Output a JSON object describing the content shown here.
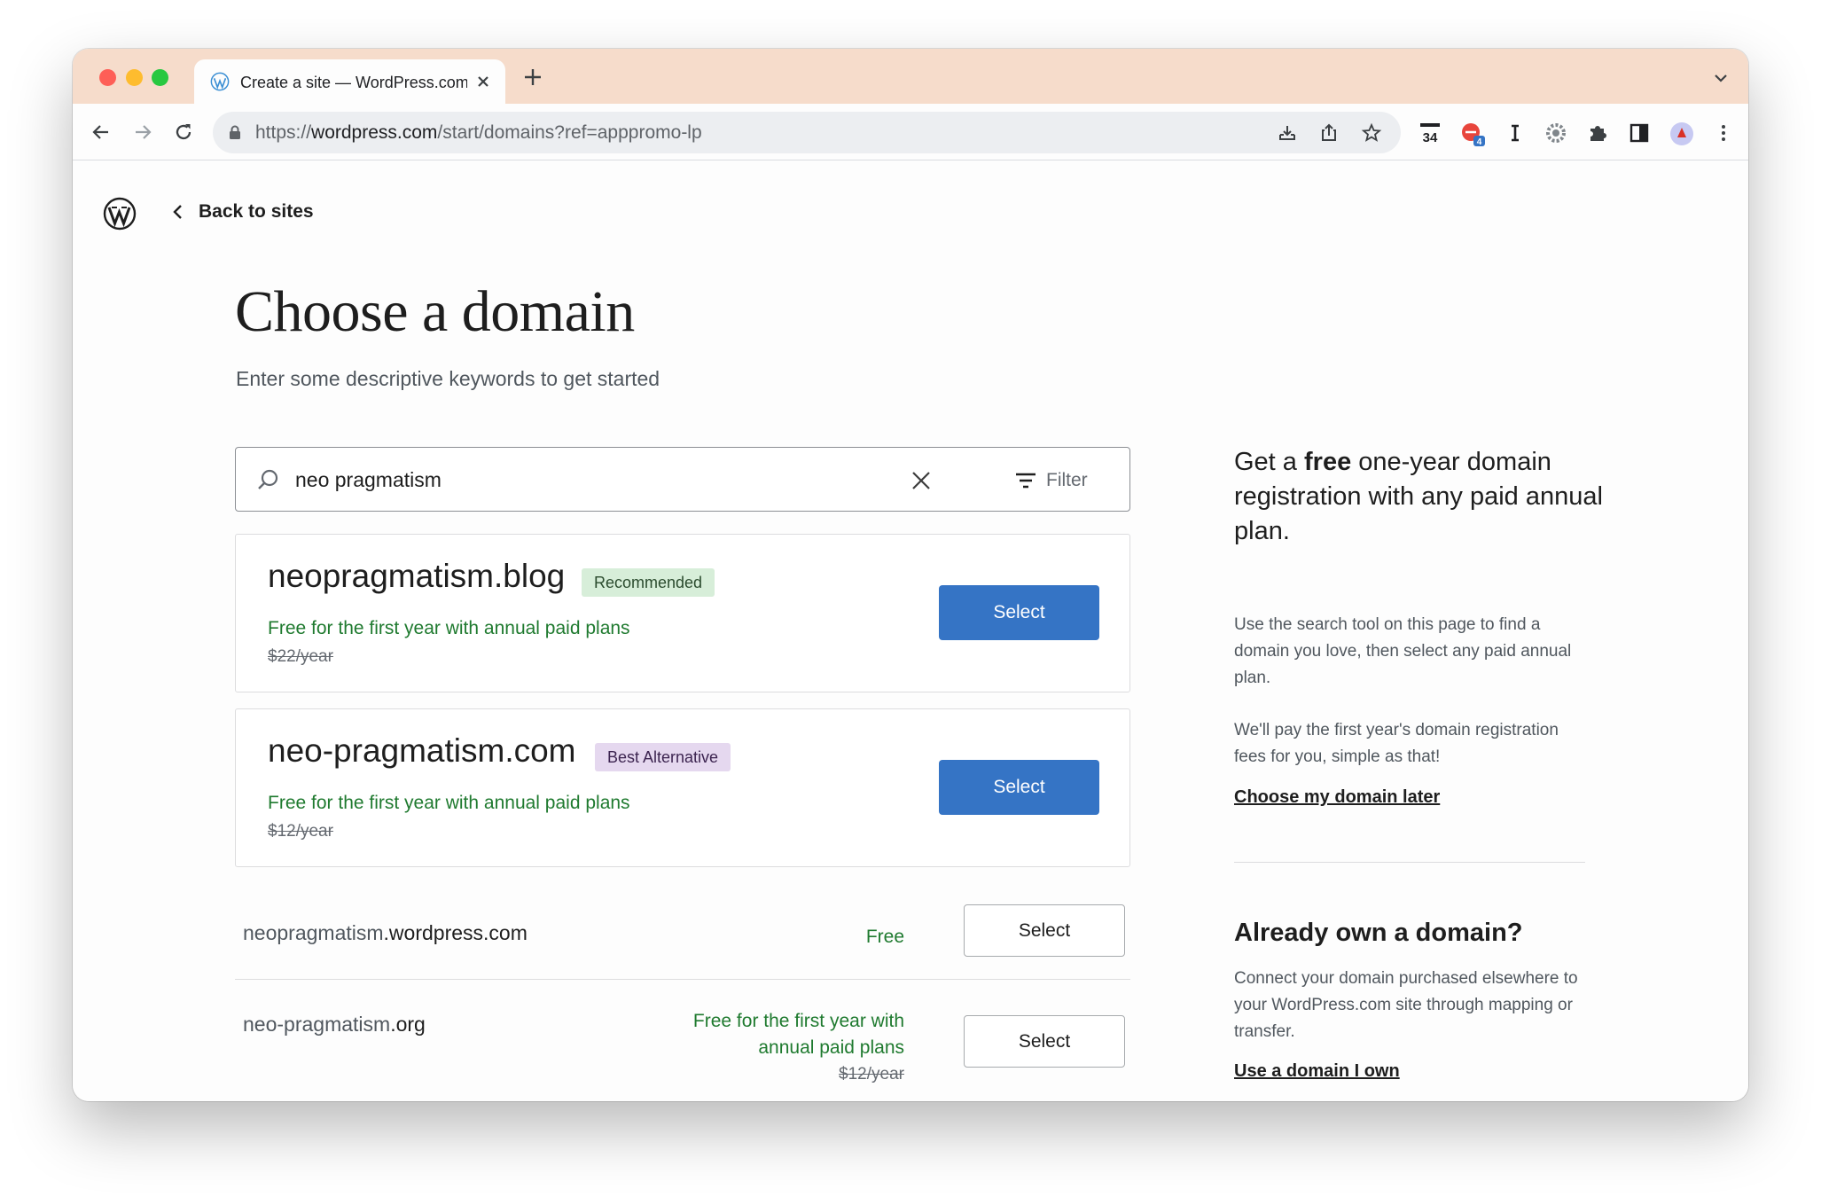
{
  "browser": {
    "tab_title": "Create a site — WordPress.com",
    "url_scheme": "https://",
    "url_host": "wordpress.com",
    "url_path": "/start/domains?ref=apppromo-lp",
    "extension_badge": "4",
    "calendar_day": "34"
  },
  "page": {
    "back_label": "Back to sites",
    "title": "Choose a domain",
    "subtitle": "Enter some descriptive keywords to get started"
  },
  "search": {
    "value": "neo pragmatism",
    "filter_label": "Filter"
  },
  "featured": [
    {
      "domain": "neopragmatism.blog",
      "badge": "Recommended",
      "free_text": "Free for the first year with annual paid plans",
      "original_price": "$22/year",
      "button": "Select"
    },
    {
      "domain": "neo-pragmatism.com",
      "badge": "Best Alternative",
      "free_text": "Free for the first year with annual paid plans",
      "original_price": "$12/year",
      "button": "Select"
    }
  ],
  "results": [
    {
      "name": "neopragmatism",
      "tld": ".wordpress.com",
      "price_text": "Free",
      "button": "Select"
    },
    {
      "name": "neo-pragmatism",
      "tld": ".org",
      "price_line1": "Free for the first year with",
      "price_line2": "annual paid plans",
      "original_price": "$12/year",
      "button": "Select"
    }
  ],
  "sidebar": {
    "promo_pre": "Get a ",
    "promo_bold": "free",
    "promo_post": " one-year domain registration with any paid annual plan.",
    "promo_text1": "Use the search tool on this page to find a domain you love, then select any paid annual plan.",
    "promo_text2": "We'll pay the first year's domain registration fees for you, simple as that!",
    "later_link": "Choose my domain later",
    "own_heading": "Already own a domain?",
    "own_text": "Connect your domain purchased elsewhere to your WordPress.com site through mapping or transfer.",
    "own_link": "Use a domain I own"
  },
  "colors": {
    "primary": "#3574c5",
    "success": "#1f7a2f",
    "tab_bar": "#f6dccb"
  }
}
